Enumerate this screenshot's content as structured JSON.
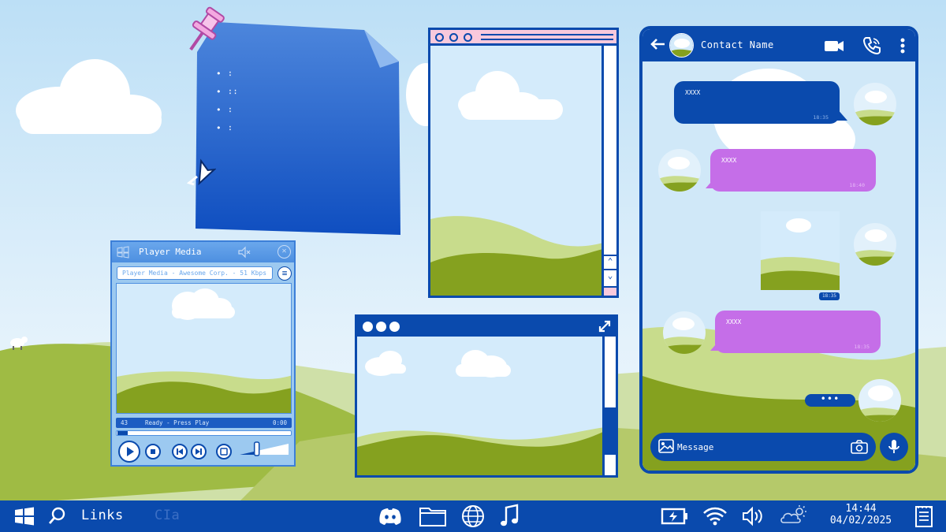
{
  "sticky_note": {
    "items": [
      "∶",
      "∶∶",
      "∶",
      "∶"
    ]
  },
  "player": {
    "title": "Player Media",
    "info": "Player Media - Awesome Corp. - 51 Kbps",
    "status_number": "43",
    "status_text": "Ready - Press Play",
    "status_time": "0:00",
    "progress_fraction": 0.06,
    "volume_fraction": 0.35
  },
  "chat": {
    "contact_name": "Contact Name",
    "messages": [
      {
        "side": "received",
        "text": "XXXX",
        "time": "18:35"
      },
      {
        "side": "sent",
        "text": "XXXX",
        "time": "18:40"
      },
      {
        "side": "received-photo",
        "time": "18:35"
      },
      {
        "side": "sent",
        "text": "XXXX",
        "time": "18:35"
      }
    ],
    "typing": "•••",
    "composer_placeholder": "Message"
  },
  "taskbar": {
    "links_label": "Links",
    "cia_label": "CIa",
    "time": "14:44",
    "date": "04/02/2025"
  },
  "colors": {
    "primary": "#0a4aad",
    "purple_bubble": "#c56ee8",
    "pink_accent": "#f9c9dc",
    "grass": "#85a11f"
  },
  "icons": [
    "windows-icon",
    "search-icon",
    "discord-icon",
    "folder-icon",
    "globe-icon",
    "music-note-icon",
    "battery-icon",
    "wifi-icon",
    "volume-icon",
    "weather-icon",
    "notes-icon",
    "video-call-icon",
    "phone-icon",
    "more-vertical-icon",
    "back-arrow-icon",
    "gallery-icon",
    "camera-icon",
    "microphone-icon"
  ]
}
